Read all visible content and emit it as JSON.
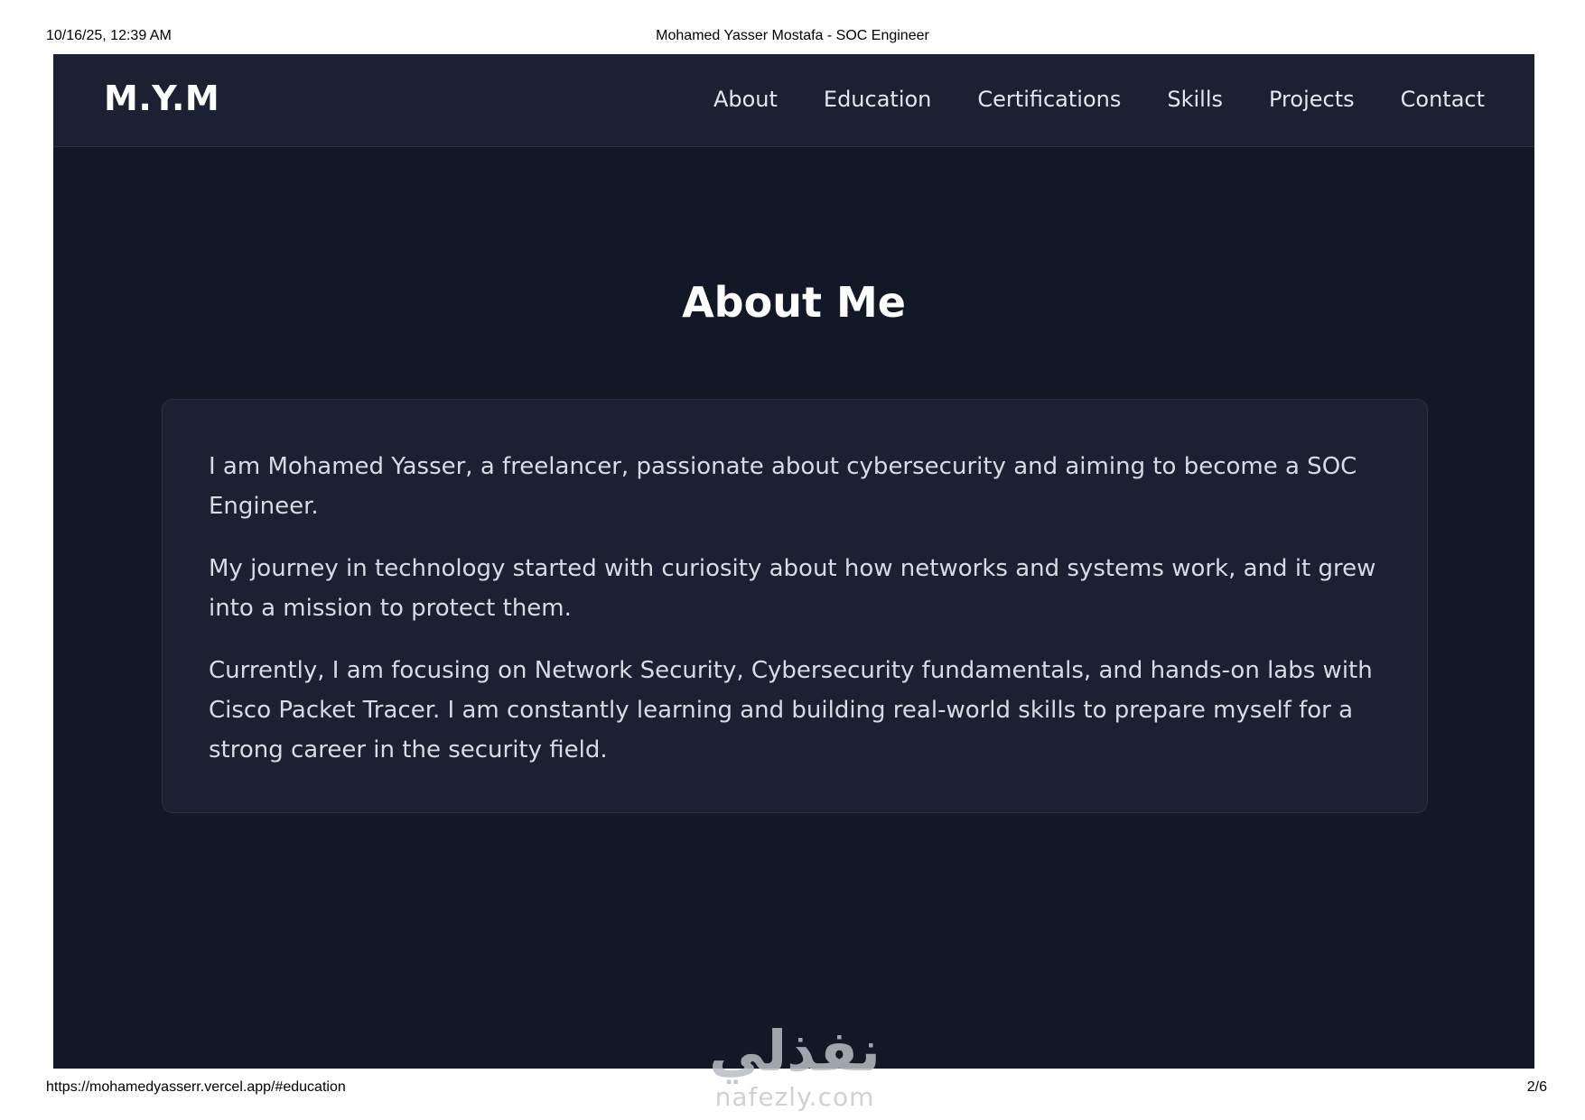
{
  "print_header": {
    "timestamp": "10/16/25, 12:39 AM",
    "document_title": "Mohamed Yasser Mostafa - SOC Engineer"
  },
  "navbar": {
    "logo": "M.Y.M",
    "links": [
      "About",
      "Education",
      "Certifications",
      "Skills",
      "Projects",
      "Contact"
    ]
  },
  "about": {
    "title": "About Me",
    "paragraphs": [
      "I am Mohamed Yasser, a freelancer, passionate about cybersecurity and aiming to become a SOC Engineer.",
      "My journey in technology started with curiosity about how networks and systems work, and it grew into a mission to protect them.",
      "Currently, I am focusing on Network Security, Cybersecurity fundamentals, and hands-on labs with Cisco Packet Tracer. I am constantly learning and building real-world skills to prepare myself for a strong career in the security field."
    ]
  },
  "print_footer": {
    "url": "https://mohamedyasserr.vercel.app/#education",
    "page_number": "2/6"
  },
  "watermark": {
    "arabic": "نفذلي",
    "latin": "nafezly.com"
  },
  "colors": {
    "page_bg": "#121826",
    "navbar_bg": "#1b2132",
    "card_bg": "#1b2132",
    "text_primary": "#ffffff",
    "text_body": "#d6dbe4"
  }
}
